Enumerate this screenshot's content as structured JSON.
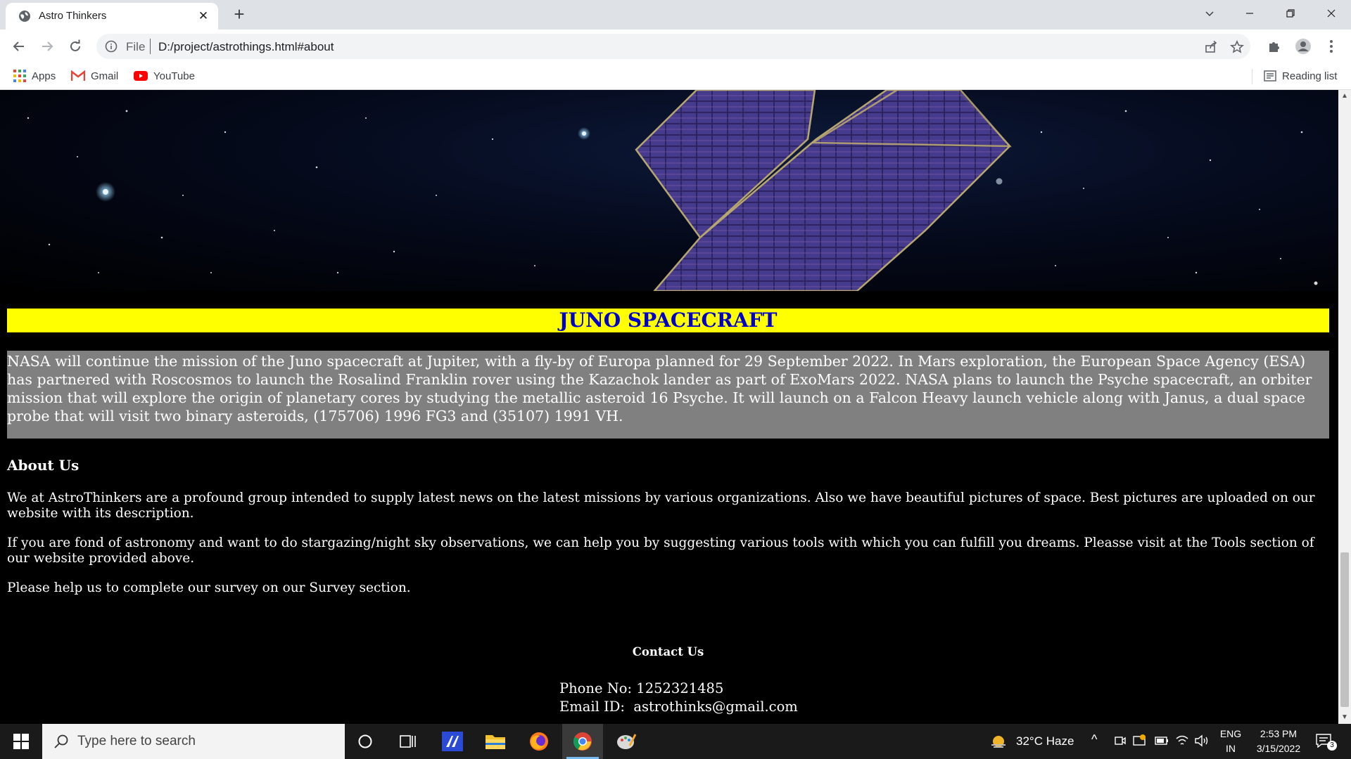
{
  "browser": {
    "tab_title": "Astro Thinkers",
    "url_scheme": "File",
    "url": "D:/project/astrothings.html#about",
    "bookmarks": [
      "Apps",
      "Gmail",
      "YouTube"
    ],
    "reading_list": "Reading list"
  },
  "page": {
    "section_title": "JUNO SPACECRAFT",
    "mission_text": "NASA will continue the mission of the Juno spacecraft at Jupiter, with a fly-by of Europa planned for 29 September 2022. In Mars exploration, the European Space Agency (ESA) has partnered with Roscosmos to launch the Rosalind Franklin rover using the Kazachok lander as part of ExoMars 2022. NASA plans to launch the Psyche spacecraft, an orbiter mission that will explore the origin of planetary cores by studying the metallic asteroid 16 Psyche. It will launch on a Falcon Heavy launch vehicle along with Janus, a dual space probe that will visit two binary asteroids, (175706) 1996 FG3 and (35107) 1991 VH.",
    "about_title": "About Us",
    "about_paragraphs": [
      "We at AstroThinkers are a profound group intended to supply latest news on the latest missions by various organizations. Also we have beautiful pictures of space. Best pictures are uploaded on our website with its description.",
      "If you are fond of astronomy and want to do stargazing/night sky observations, we can help you by suggesting various tools with which you can fulfill you dreams. Pleasse visit at the Tools section of our website provided above.",
      "Please help us to complete our survey on our Survey section."
    ],
    "contact_title": "Contact Us",
    "phone_line": "Phone No: 1252321485",
    "email_line": "Email ID:  astrothinks@gmail.com"
  },
  "taskbar": {
    "search_placeholder": "Type here to search",
    "weather": "32°C  Haze",
    "lang_top": "ENG",
    "lang_bottom": "IN",
    "time": "2:53 PM",
    "date": "3/15/2022",
    "notification_count": "3"
  },
  "colors": {
    "heading_bg": "#ffff00",
    "heading_text": "#0000cc",
    "mission_bg": "#808080",
    "page_bg": "#000000"
  }
}
